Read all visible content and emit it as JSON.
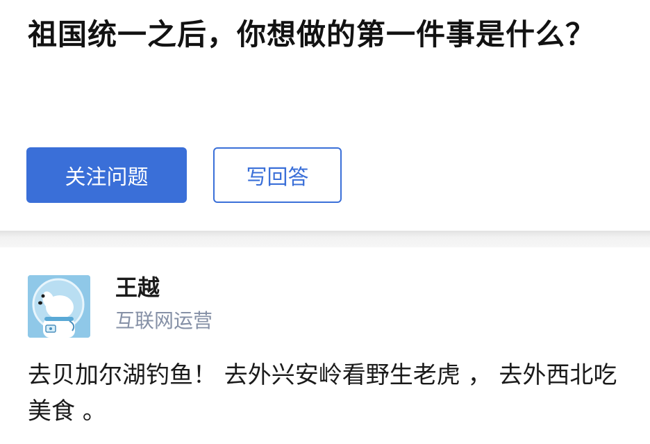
{
  "question": {
    "title": "祖国统一之后，你想做的第一件事是什么？"
  },
  "actions": {
    "follow_label": "关注问题",
    "answer_label": "写回答"
  },
  "answer": {
    "author_name": "王越",
    "author_headline": "互联网运营",
    "content": "去贝加尔湖钓鱼！ 去外兴安岭看野生老虎 ， 去外西北吃美食 。"
  },
  "colors": {
    "accent": "#3a6fd8",
    "secondary_text": "#8590a6",
    "divider": "#f2f2f2"
  },
  "icons": {
    "avatar": "astronaut-dog-avatar"
  }
}
